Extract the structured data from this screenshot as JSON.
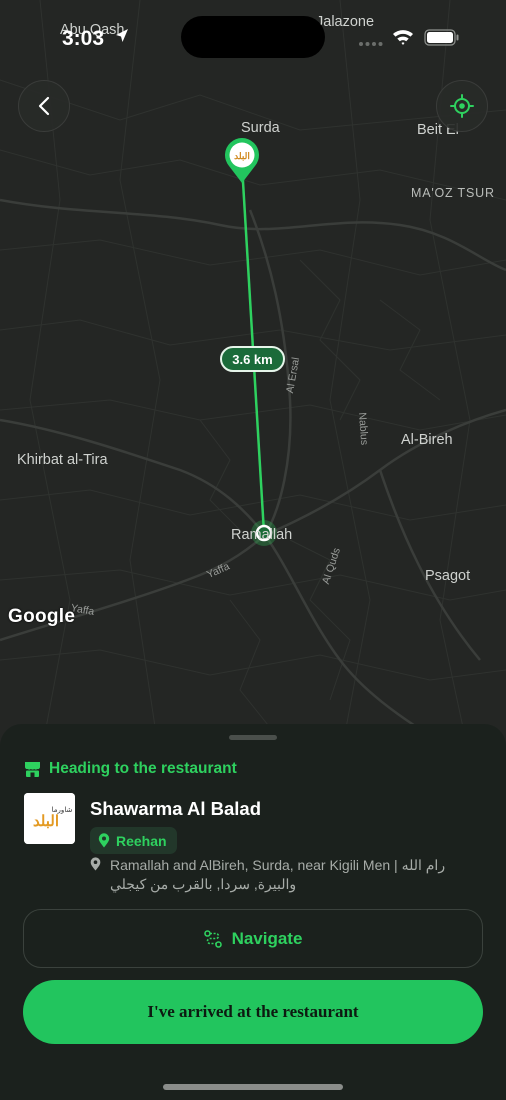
{
  "status_bar": {
    "time": "3:03"
  },
  "map": {
    "labels": {
      "abu_qash": "Abu Qash",
      "jalazone": "Jalazone",
      "surda": "Surda",
      "beit_el": "Beit El",
      "maoz_tsur": "MA'OZ TSUR",
      "al_ersal": "Al Ersal",
      "nablus": "Nablus",
      "al_bireh": "Al-Bireh",
      "khirbat": "Khirbat al-Tira",
      "ramallah": "Ramallah",
      "yaffa1": "Yaffa",
      "yaffa2": "Yaffa",
      "al_quds": "Al Quds",
      "psagot": "Psagot"
    },
    "distance": "3.6 km",
    "attribution": "Google"
  },
  "sheet": {
    "heading": "Heading to the restaurant",
    "restaurant_name": "Shawarma Al Balad",
    "logo_text": "البلد",
    "logo_small": "شاورما",
    "area_chip": "Reehan",
    "address": "Ramallah and AlBireh, Surda, near Kigili Men | رام الله والبيرة, سردا, بالقرب من كيجلي",
    "navigate_label": "Navigate",
    "arrived_label": "I've arrived at the restaurant"
  },
  "colors": {
    "accent": "#22c55e",
    "map_bg": "#242624",
    "sheet_bg": "#1b211d"
  }
}
